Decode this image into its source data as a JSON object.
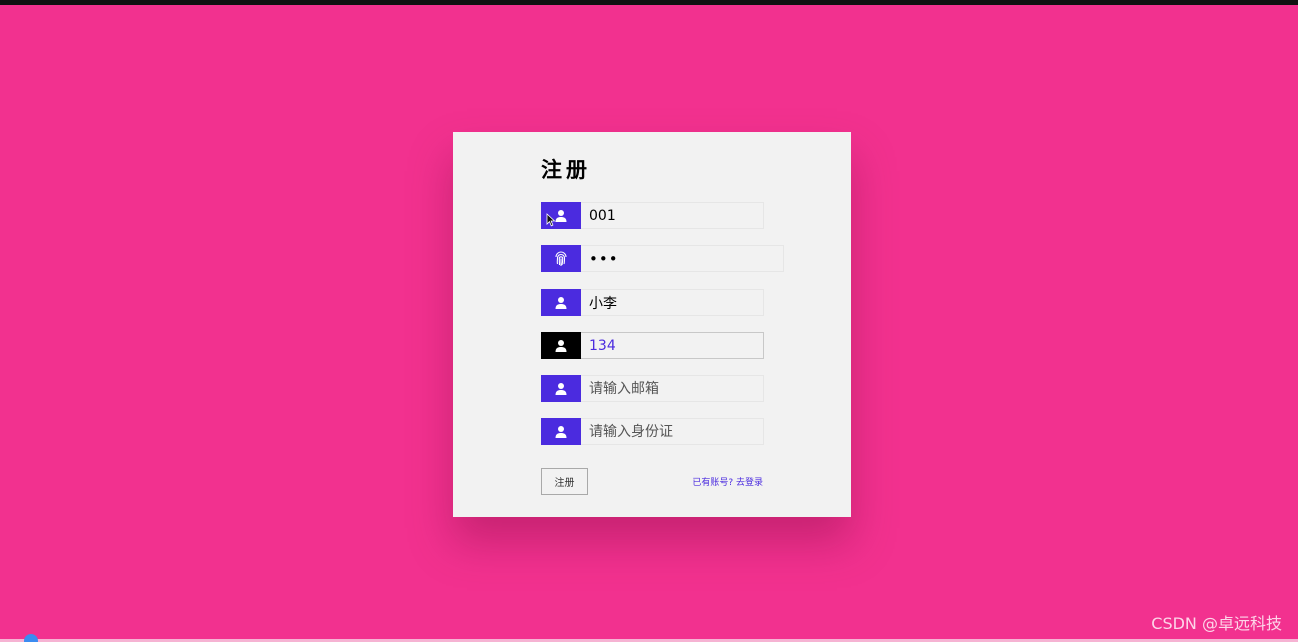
{
  "form": {
    "title": "注册",
    "fields": [
      {
        "name": "username",
        "icon": "user-icon",
        "value": "001",
        "placeholder": ""
      },
      {
        "name": "password",
        "icon": "fingerprint-icon",
        "value": "•••",
        "placeholder": ""
      },
      {
        "name": "nickname",
        "icon": "user-icon",
        "value": "小李",
        "placeholder": ""
      },
      {
        "name": "phone",
        "icon": "user-icon",
        "value": "134",
        "placeholder": ""
      },
      {
        "name": "email",
        "icon": "user-icon",
        "value": "",
        "placeholder": "请输入邮箱"
      },
      {
        "name": "id-card",
        "icon": "user-icon",
        "value": "",
        "placeholder": "请输入身份证"
      }
    ],
    "submit_label": "注册",
    "login_link": "已有账号? 去登录"
  },
  "watermark": "CSDN @卓远科技",
  "colors": {
    "background": "#f2318f",
    "card": "#f2f2f2",
    "accent": "#4b2bdf",
    "active_icon": "#000000"
  }
}
